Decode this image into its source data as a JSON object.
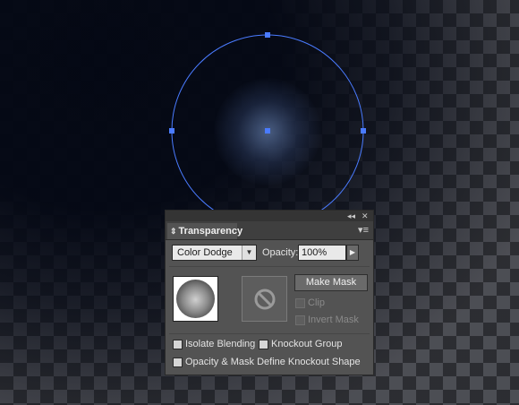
{
  "panel": {
    "title": "Transparency",
    "title_arrows": "⇕",
    "collapse_label": "◂◂",
    "close_label": "✕",
    "menu_label": "▾≡",
    "blend_mode": "Color Dodge",
    "blend_arrow": "▼",
    "opacity_label": "Opacity:",
    "opacity_value": "100%",
    "opacity_arrow": "▶",
    "make_mask_label": "Make Mask",
    "clip_label": "Clip",
    "invert_mask_label": "Invert Mask",
    "isolate_blending_label": "Isolate Blending",
    "knockout_group_label": "Knockout Group",
    "opacity_mask_define_label": "Opacity & Mask Define Knockout Shape"
  },
  "icons": {
    "no_mask": "no-mask-icon",
    "expand": "expand-arrows-icon",
    "menu": "panel-menu-icon"
  },
  "colors": {
    "selection": "#4a7bff",
    "panel_bg": "#535353",
    "field_bg": "#e9e9e9"
  }
}
